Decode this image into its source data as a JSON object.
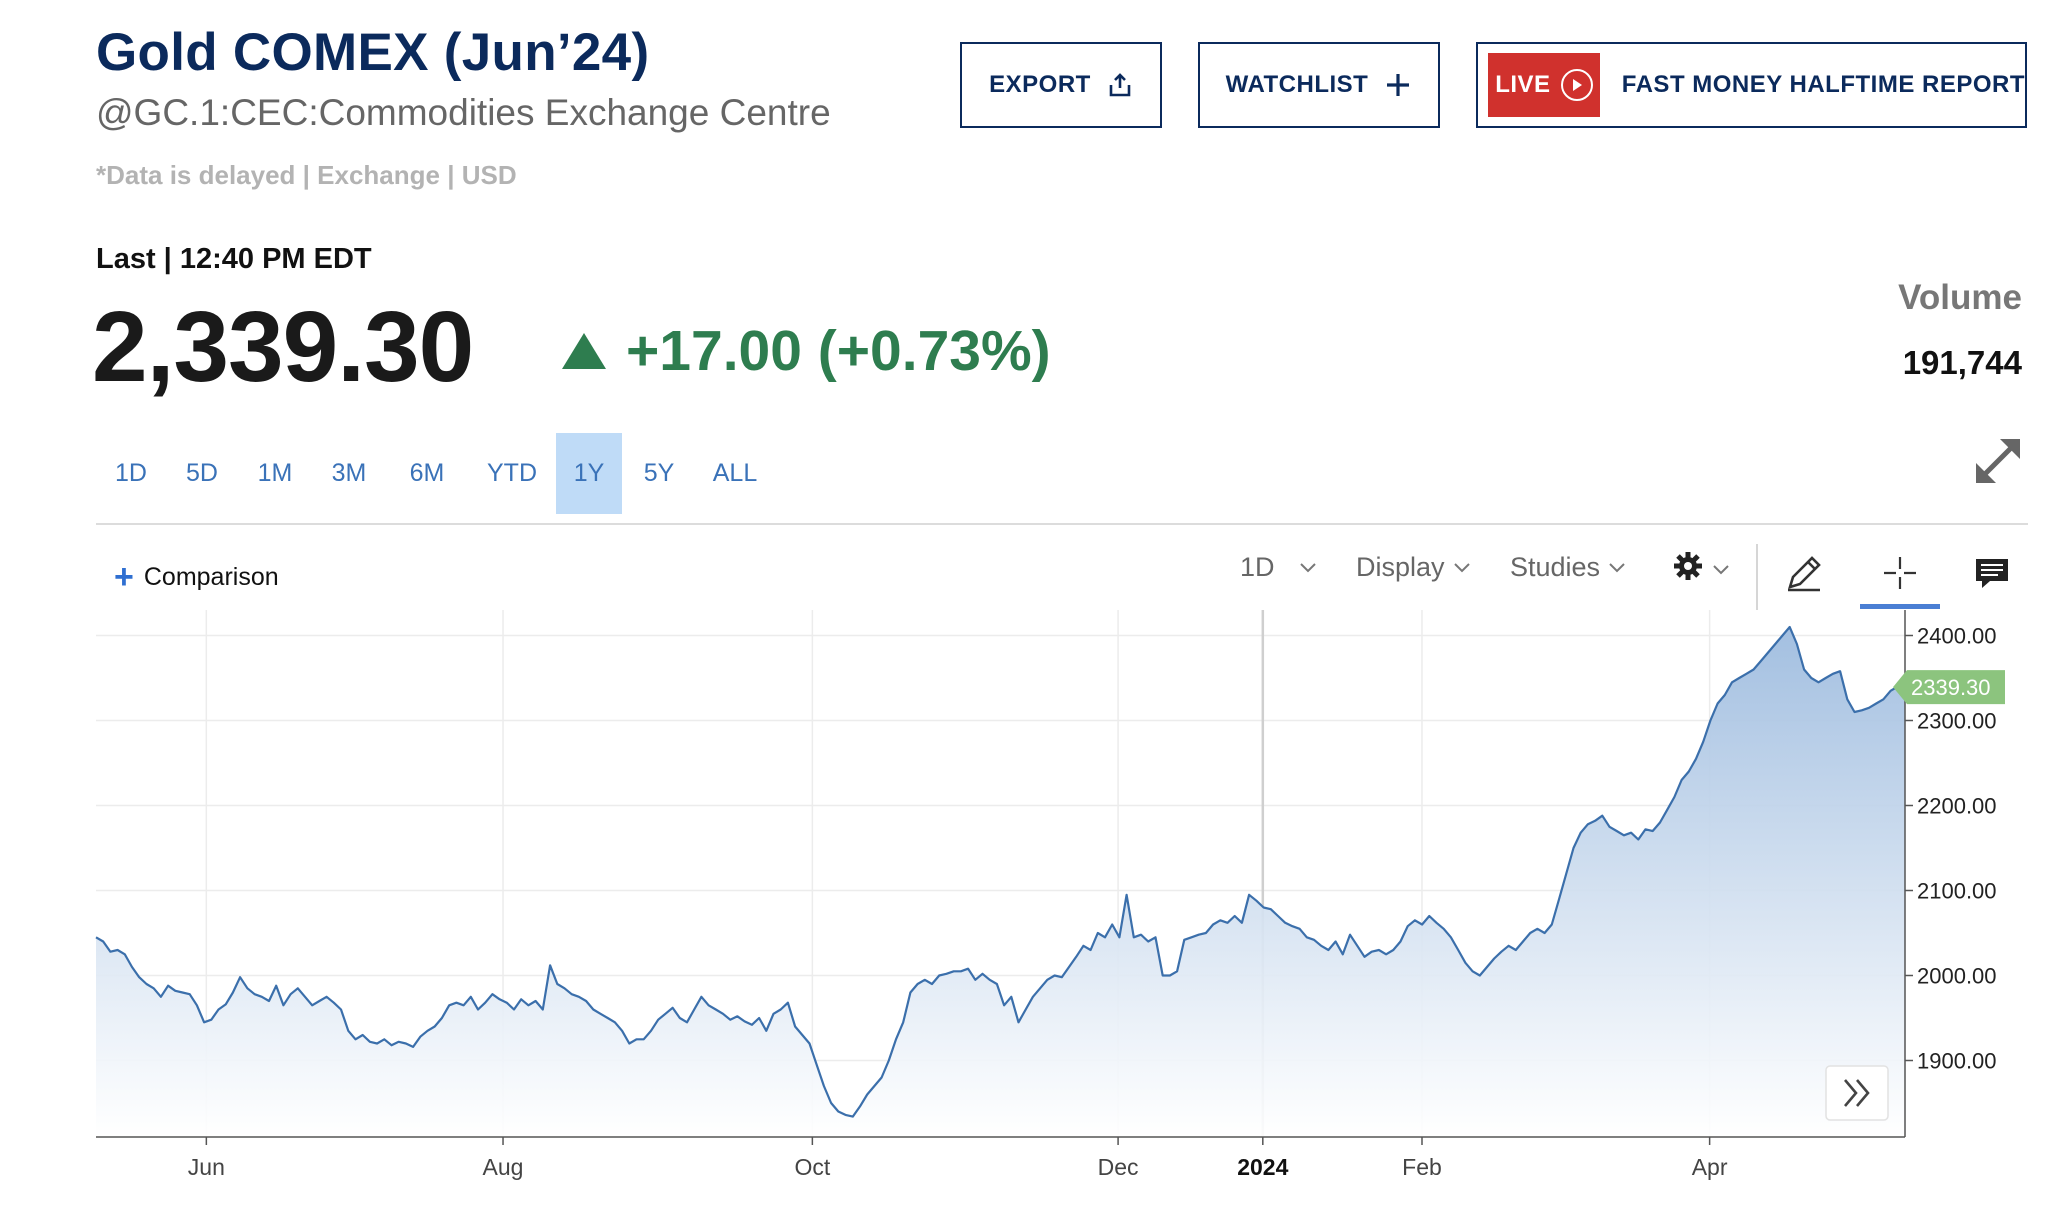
{
  "header": {
    "title": "Gold COMEX (Jun’24)",
    "subtitle": "@GC.1:CEC:Commodities Exchange Centre",
    "delayed": "*Data is delayed | Exchange | USD"
  },
  "actions": {
    "export_label": "EXPORT",
    "watchlist_label": "WATCHLIST",
    "live_label": "LIVE",
    "live_show": "FAST MONEY HALFTIME REPORT"
  },
  "quote": {
    "last_label": "Last | 12:40 PM EDT",
    "price": "2,339.30",
    "change": "+17.00 (+0.73%)",
    "volume_label": "Volume",
    "volume": "191,744"
  },
  "ranges": [
    "1D",
    "5D",
    "1M",
    "3M",
    "6M",
    "YTD",
    "1Y",
    "5Y",
    "ALL"
  ],
  "active_range": "1Y",
  "toolbar": {
    "comparison": "Comparison",
    "interval": "1D",
    "display": "Display",
    "studies": "Studies"
  },
  "colors": {
    "brand": "#0b2a5c",
    "up": "#2e7d4f",
    "live": "#d0312d",
    "line": "#3b6fab",
    "last_tag": "#8cc47e"
  },
  "icons": [
    "share-icon",
    "plus-icon",
    "play-icon",
    "expand-icon",
    "chevron-down-icon",
    "gear-icon",
    "pencil-icon",
    "crosshair-icon",
    "comment-icon",
    "double-chevron-right-icon"
  ],
  "chart_data": {
    "type": "area",
    "x_ticks": [
      "Jun",
      "Aug",
      "Oct",
      "Dec",
      "2024",
      "Feb",
      "Apr"
    ],
    "y_ticks": [
      "2400.00",
      "2300.00",
      "2200.00",
      "2100.00",
      "2000.00",
      "1900.00"
    ],
    "ylim": [
      1810,
      2430
    ],
    "last_value_label": "2339.30",
    "series": [
      {
        "values": [
          2045,
          2040,
          2028,
          2030,
          2025,
          2010,
          1998,
          1990,
          1985,
          1975,
          1988,
          1982,
          1980,
          1978,
          1965,
          1945,
          1948,
          1960,
          1966,
          1980,
          1998,
          1985,
          1978,
          1975,
          1970,
          1988,
          1965,
          1978,
          1985,
          1975,
          1965,
          1970,
          1975,
          1968,
          1960,
          1935,
          1925,
          1930,
          1922,
          1920,
          1925,
          1918,
          1922,
          1920,
          1916,
          1928,
          1935,
          1940,
          1950,
          1965,
          1968,
          1965,
          1975,
          1960,
          1968,
          1978,
          1972,
          1968,
          1960,
          1972,
          1965,
          1970,
          1960,
          2012,
          1990,
          1985,
          1978,
          1975,
          1970,
          1960,
          1955,
          1950,
          1945,
          1935,
          1920,
          1925,
          1925,
          1935,
          1948,
          1955,
          1962,
          1950,
          1945,
          1960,
          1975,
          1965,
          1960,
          1955,
          1948,
          1952,
          1946,
          1942,
          1950,
          1935,
          1955,
          1960,
          1968,
          1940,
          1930,
          1920,
          1895,
          1870,
          1850,
          1840,
          1836,
          1834,
          1846,
          1860,
          1870,
          1880,
          1900,
          1925,
          1945,
          1980,
          1990,
          1995,
          1990,
          2000,
          2002,
          2005,
          2005,
          2008,
          1995,
          2002,
          1995,
          1990,
          1965,
          1975,
          1945,
          1960,
          1975,
          1985,
          1995,
          2000,
          1998,
          2010,
          2022,
          2035,
          2030,
          2050,
          2045,
          2060,
          2045,
          2095,
          2045,
          2048,
          2040,
          2045,
          2000,
          2000,
          2005,
          2042,
          2045,
          2048,
          2050,
          2060,
          2065,
          2062,
          2070,
          2062,
          2095,
          2088,
          2080,
          2078,
          2070,
          2062,
          2058,
          2055,
          2045,
          2042,
          2035,
          2030,
          2040,
          2025,
          2048,
          2035,
          2022,
          2028,
          2030,
          2025,
          2030,
          2040,
          2058,
          2065,
          2060,
          2070,
          2062,
          2055,
          2045,
          2030,
          2015,
          2005,
          2000,
          2010,
          2020,
          2028,
          2035,
          2030,
          2040,
          2050,
          2055,
          2050,
          2060,
          2090,
          2120,
          2150,
          2168,
          2178,
          2182,
          2188,
          2175,
          2170,
          2165,
          2168,
          2160,
          2172,
          2170,
          2180,
          2195,
          2210,
          2230,
          2240,
          2255,
          2275,
          2300,
          2320,
          2330,
          2345,
          2350,
          2355,
          2360,
          2370,
          2380,
          2390,
          2400,
          2410,
          2390,
          2360,
          2350,
          2345,
          2350,
          2355,
          2358,
          2325,
          2310,
          2312,
          2315,
          2320,
          2325,
          2335,
          2340,
          2339.3
        ]
      }
    ],
    "grid": true
  }
}
